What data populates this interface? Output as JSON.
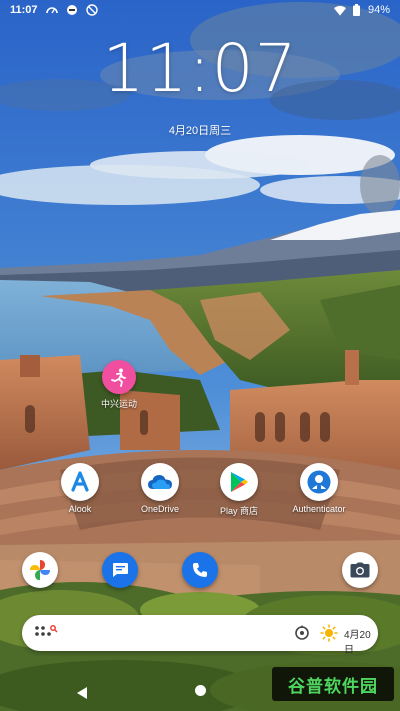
{
  "status_bar": {
    "time": "11:07",
    "battery": "94%",
    "icons": [
      "gauge-icon",
      "app-notification-icon",
      "dnd-off-icon",
      "wifi-icon",
      "battery-icon"
    ]
  },
  "clock": {
    "time": "11:07",
    "date": "4月20日周三"
  },
  "apps": {
    "zhongxing": {
      "label": "中兴运动",
      "icon": "running-person-icon",
      "color": "#f04fa0"
    },
    "alook": {
      "label": "Alook",
      "icon": "letter-a-icon",
      "color": "#1e88e5"
    },
    "onedrive": {
      "label": "OneDrive",
      "icon": "cloud-icon",
      "color": "#1565c0"
    },
    "playstore": {
      "label": "Play 商店",
      "icon": "play-triangle-icon"
    },
    "authenticator": {
      "label": "Authenticator",
      "icon": "person-lock-icon",
      "color": "#1e78d8"
    }
  },
  "dock": [
    {
      "name": "photos",
      "icon": "pinwheel-icon"
    },
    {
      "name": "messages",
      "icon": "message-icon",
      "color": "#1a73e8"
    },
    {
      "name": "phone",
      "icon": "phone-icon",
      "color": "#1a73e8"
    },
    {
      "name": "camera",
      "icon": "camera-icon"
    }
  ],
  "search": {
    "date": "4月20日",
    "icons": [
      "apps-dots-icon",
      "lens-icon",
      "sun-icon"
    ]
  },
  "watermark": {
    "text": "谷普软件园"
  }
}
